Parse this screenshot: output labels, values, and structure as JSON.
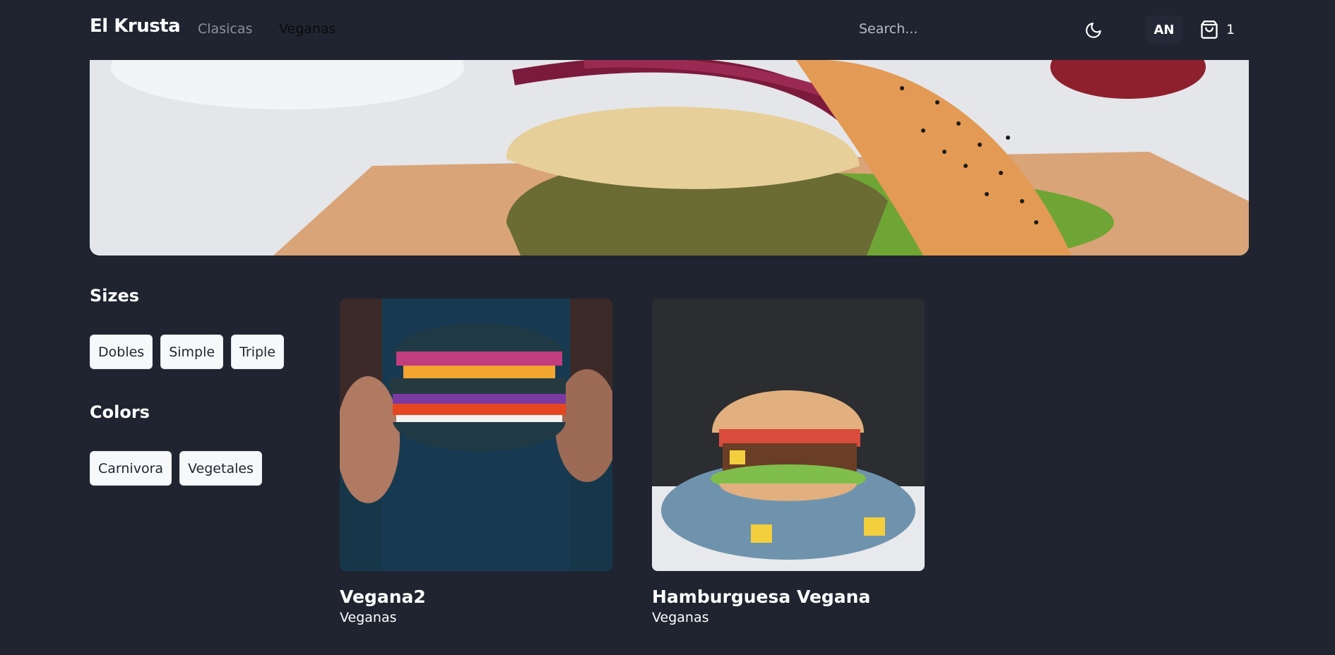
{
  "nav": {
    "brand": "El Krusta",
    "links": [
      "Clasicas",
      "Veganas"
    ],
    "search_placeholder": "Search...",
    "avatar_initials": "AN",
    "cart_count": "1"
  },
  "sidebar": {
    "sizes_title": "Sizes",
    "sizes": [
      "Dobles",
      "Simple",
      "Triple"
    ],
    "colors_title": "Colors",
    "colors": [
      "Carnivora",
      "Vegetales"
    ]
  },
  "products": [
    {
      "name": "Vegana2",
      "category": "Veganas",
      "price": ""
    },
    {
      "name": "Hamburguesa Vegana",
      "category": "Veganas",
      "price": ""
    }
  ],
  "colors": {
    "background": "#1f2430",
    "chip_bg": "#f7f8fa",
    "muted_link": "#8a909c"
  }
}
